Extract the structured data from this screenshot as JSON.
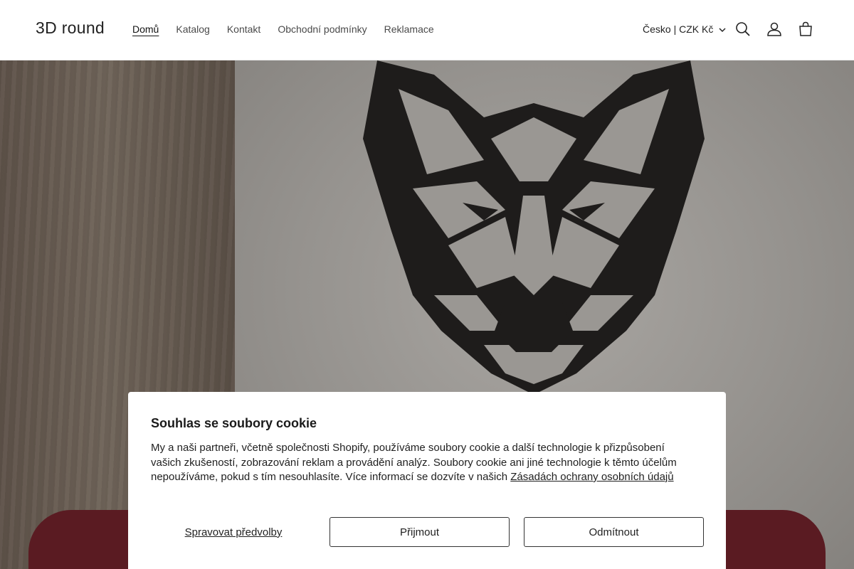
{
  "header": {
    "logo": "3D round",
    "nav": [
      {
        "label": "Domů"
      },
      {
        "label": "Katalog"
      },
      {
        "label": "Kontakt"
      },
      {
        "label": "Obchodní podmínky"
      },
      {
        "label": "Reklamace"
      }
    ],
    "locale": "Česko | CZK Kč",
    "icons": [
      "search-icon",
      "account-icon",
      "cart-icon",
      "chevron-down-icon"
    ]
  },
  "hero": {
    "image": "geometric wolf head wall decor"
  },
  "cookie": {
    "title": "Souhlas se soubory cookie",
    "text": "My a naši partneři, včetně společnosti Shopify, používáme soubory cookie a další technologie k přizpůsobení vašich zkušeností, zobrazování reklam a provádění analýz. Soubory cookie ani jiné technologie k těmto účelům nepoužíváme, pokud s tím nesouhlasíte. Více informací se dozvíte v našich ",
    "link": "Zásadách ochrany osobních údajů",
    "manage_label": "Spravovat předvolby",
    "accept_label": "Přijmout",
    "decline_label": "Odmítnout"
  }
}
